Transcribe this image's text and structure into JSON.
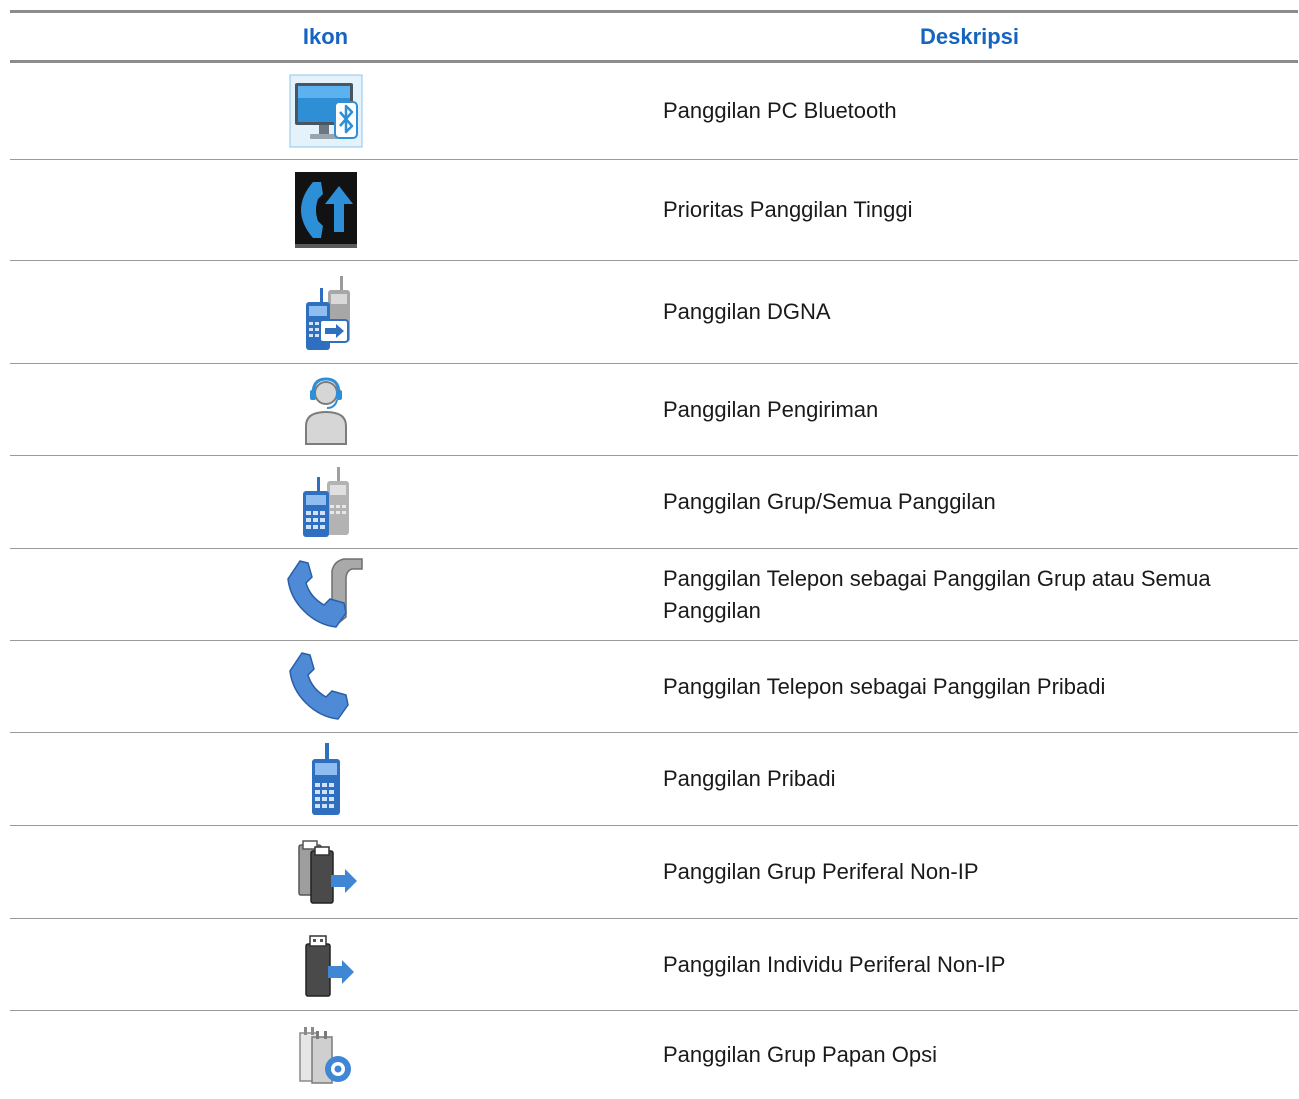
{
  "table": {
    "headers": {
      "icon": "Ikon",
      "description": "Deskripsi"
    },
    "rows": [
      {
        "icon": "bluetooth-pc-icon",
        "description": "Panggilan PC Bluetooth"
      },
      {
        "icon": "high-priority-call-icon",
        "description": "Prioritas Panggilan Tinggi"
      },
      {
        "icon": "dgna-call-icon",
        "description": "Panggilan DGNA"
      },
      {
        "icon": "dispatch-call-icon",
        "description": "Panggilan Pengiriman"
      },
      {
        "icon": "group-call-icon",
        "description": "Panggilan Grup/Semua Panggilan"
      },
      {
        "icon": "phone-group-call-icon",
        "description": "Panggilan Telepon sebagai Panggilan Grup atau Semua Panggilan"
      },
      {
        "icon": "phone-private-call-icon",
        "description": "Panggilan Telepon sebagai Panggilan Pribadi"
      },
      {
        "icon": "private-call-icon",
        "description": "Panggilan Pribadi"
      },
      {
        "icon": "non-ip-peripheral-group-call-icon",
        "description": "Panggilan Grup Periferal Non-IP"
      },
      {
        "icon": "non-ip-peripheral-individual-call-icon",
        "description": "Panggilan Individu Periferal Non-IP"
      },
      {
        "icon": "option-board-group-call-icon",
        "description": "Panggilan Grup Papan Opsi"
      }
    ]
  },
  "colors": {
    "header_text": "#1565c0",
    "rule": "#8c8c8c",
    "icon_blue": "#3a78c9"
  }
}
